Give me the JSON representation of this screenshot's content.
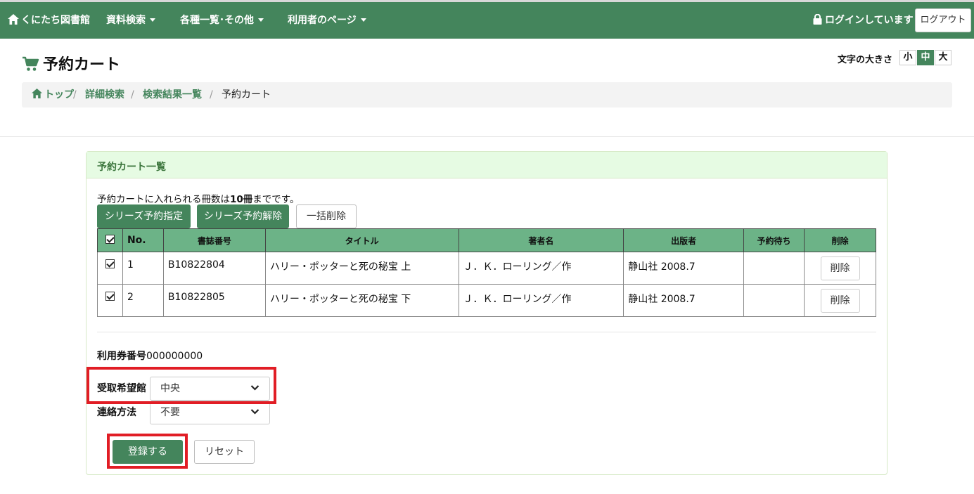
{
  "navbar": {
    "brand": "くにたち図書館",
    "menus": [
      "資料検索",
      "各種一覧･その他",
      "利用者のページ"
    ],
    "login_status": "ログインしています",
    "logout_label": "ログアウト"
  },
  "page": {
    "title": "予約カート",
    "font_size_label": "文字の大きさ",
    "font_sizes": [
      "小",
      "中",
      "大"
    ],
    "font_size_active": "中"
  },
  "breadcrumb": [
    "トップ",
    "詳細検索",
    "検索結果一覧",
    "予約カート"
  ],
  "panel": {
    "title": "予約カート一覧",
    "note_prefix": "予約カートに入れられる冊数は",
    "note_bold": "10冊",
    "note_suffix": "までです。",
    "buttons": {
      "series_set": "シリーズ予約指定",
      "series_unset": "シリーズ予約解除",
      "bulk_delete": "一括削除"
    },
    "table": {
      "headers": [
        "No.",
        "書誌番号",
        "タイトル",
        "著者名",
        "出版者",
        "予約待ち",
        "削除"
      ],
      "rows": [
        {
          "no": "1",
          "id": "B10822804",
          "title": "ハリー・ポッターと死の秘宝 上",
          "author": "Ｊ．Ｋ．ローリング／作",
          "publisher": "静山社 2008.7",
          "waiting": "",
          "delete": "削除"
        },
        {
          "no": "2",
          "id": "B10822805",
          "title": "ハリー・ポッターと死の秘宝 下",
          "author": "Ｊ．Ｋ．ローリング／作",
          "publisher": "静山社 2008.7",
          "waiting": "",
          "delete": "削除"
        }
      ]
    }
  },
  "form": {
    "card_label": "利用券番号",
    "card_number": "000000000",
    "pickup_label": "受取希望館",
    "pickup_value": "中央",
    "contact_label": "連絡方法",
    "contact_value": "不要",
    "submit_label": "登録する",
    "reset_label": "リセット"
  },
  "colors": {
    "brand_green": "#44855c",
    "table_header": "#6cb387",
    "panel_header": "#e6fbe3",
    "highlight_red": "#e11d25"
  }
}
